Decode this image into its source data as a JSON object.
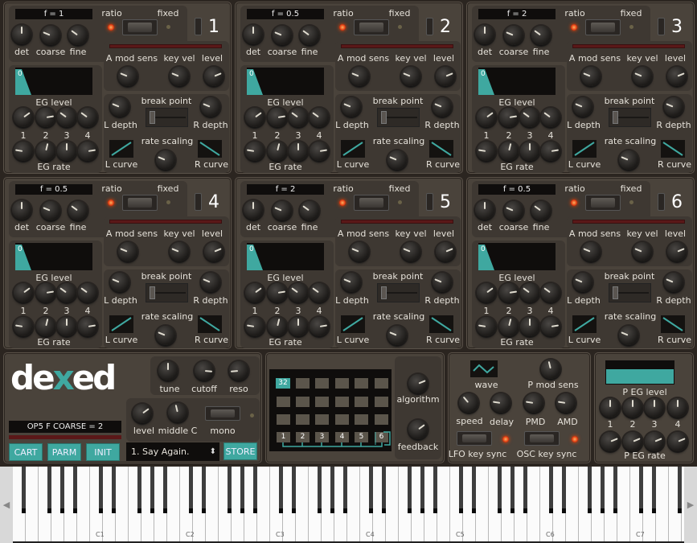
{
  "labels": {
    "ratio": "ratio",
    "fixed": "fixed",
    "det": "det",
    "coarse": "coarse",
    "fine": "fine",
    "amod": "A mod sens",
    "keyvel": "key vel",
    "level": "level",
    "eglevel": "EG level",
    "egrate": "EG rate",
    "breakpoint": "break point",
    "ldepth": "L depth",
    "rdepth": "R depth",
    "ratescaling": "rate scaling",
    "lcurve": "L curve",
    "rcurve": "R curve",
    "eg_display_value": "0",
    "n1": "1",
    "n2": "2",
    "n3": "3",
    "n4": "4"
  },
  "operators": [
    {
      "number": "1",
      "freq": "f = 1",
      "ratio_mode": true
    },
    {
      "number": "2",
      "freq": "f = 0.5",
      "ratio_mode": true
    },
    {
      "number": "3",
      "freq": "f = 2",
      "ratio_mode": true
    },
    {
      "number": "4",
      "freq": "f = 0.5",
      "ratio_mode": true
    },
    {
      "number": "5",
      "freq": "f = 2",
      "ratio_mode": true
    },
    {
      "number": "6",
      "freq": "f = 0.5",
      "ratio_mode": true
    }
  ],
  "operator_knob_values": {
    "det": 0.5,
    "coarse": 0.25,
    "fine": 0.3,
    "amod": 0.25,
    "keyvel": 0.25,
    "level": 0.75,
    "eg_level": [
      0.7,
      0.8,
      0.3,
      0.3
    ],
    "eg_rate": [
      0.2,
      0.55,
      0.5,
      0.8
    ],
    "ldepth": 0.25,
    "rdepth": 0.25,
    "ratescaling": 0.25
  },
  "global": {
    "logo": "dexed",
    "tune": "tune",
    "cutoff": "cutoff",
    "reso": "reso",
    "level": "level",
    "middle_c": "middle C",
    "mono": "mono",
    "status": "OP5 F COARSE = 2",
    "cart": "CART",
    "parm": "PARM",
    "init": "INIT",
    "preset": "1. Say Again.",
    "store": "STORE",
    "knobs": {
      "tune": 0.5,
      "cutoff": 0.85,
      "reso": 0.15,
      "level": 0.7,
      "middle_c": 0.45
    }
  },
  "algorithm": {
    "number": "32",
    "ops": [
      "1",
      "2",
      "3",
      "4",
      "5",
      "6"
    ],
    "algorithm_label": "algorithm",
    "feedback_label": "feedback",
    "knobs": {
      "algorithm": 0.75,
      "feedback": 0.7
    }
  },
  "lfo": {
    "wave": "wave",
    "pmodsens": "P mod sens",
    "speed": "speed",
    "delay": "delay",
    "pmd": "PMD",
    "amd": "AMD",
    "lfo_key_sync": "LFO key sync",
    "osc_key_sync": "OSC key sync",
    "wave_shape": "triangle",
    "knobs": {
      "pmodsens": 0.45,
      "speed": 0.35,
      "delay": 0.2,
      "pmd": 0.2,
      "amd": 0.2
    }
  },
  "pitch_eg": {
    "level_label": "P EG level",
    "rate_label": "P EG rate",
    "numbers": [
      "1",
      "2",
      "3",
      "4"
    ],
    "level_knobs": [
      0.5,
      0.5,
      0.5,
      0.5
    ],
    "rate_knobs": [
      0.75,
      0.75,
      0.75,
      0.75
    ]
  },
  "keyboard": {
    "octave_labels": [
      "C1",
      "C2",
      "C3",
      "C4",
      "C5",
      "C6",
      "C7"
    ]
  },
  "colors": {
    "accent": "#3fa8a0",
    "led": "#e03a10",
    "panel": "#4a433b"
  }
}
